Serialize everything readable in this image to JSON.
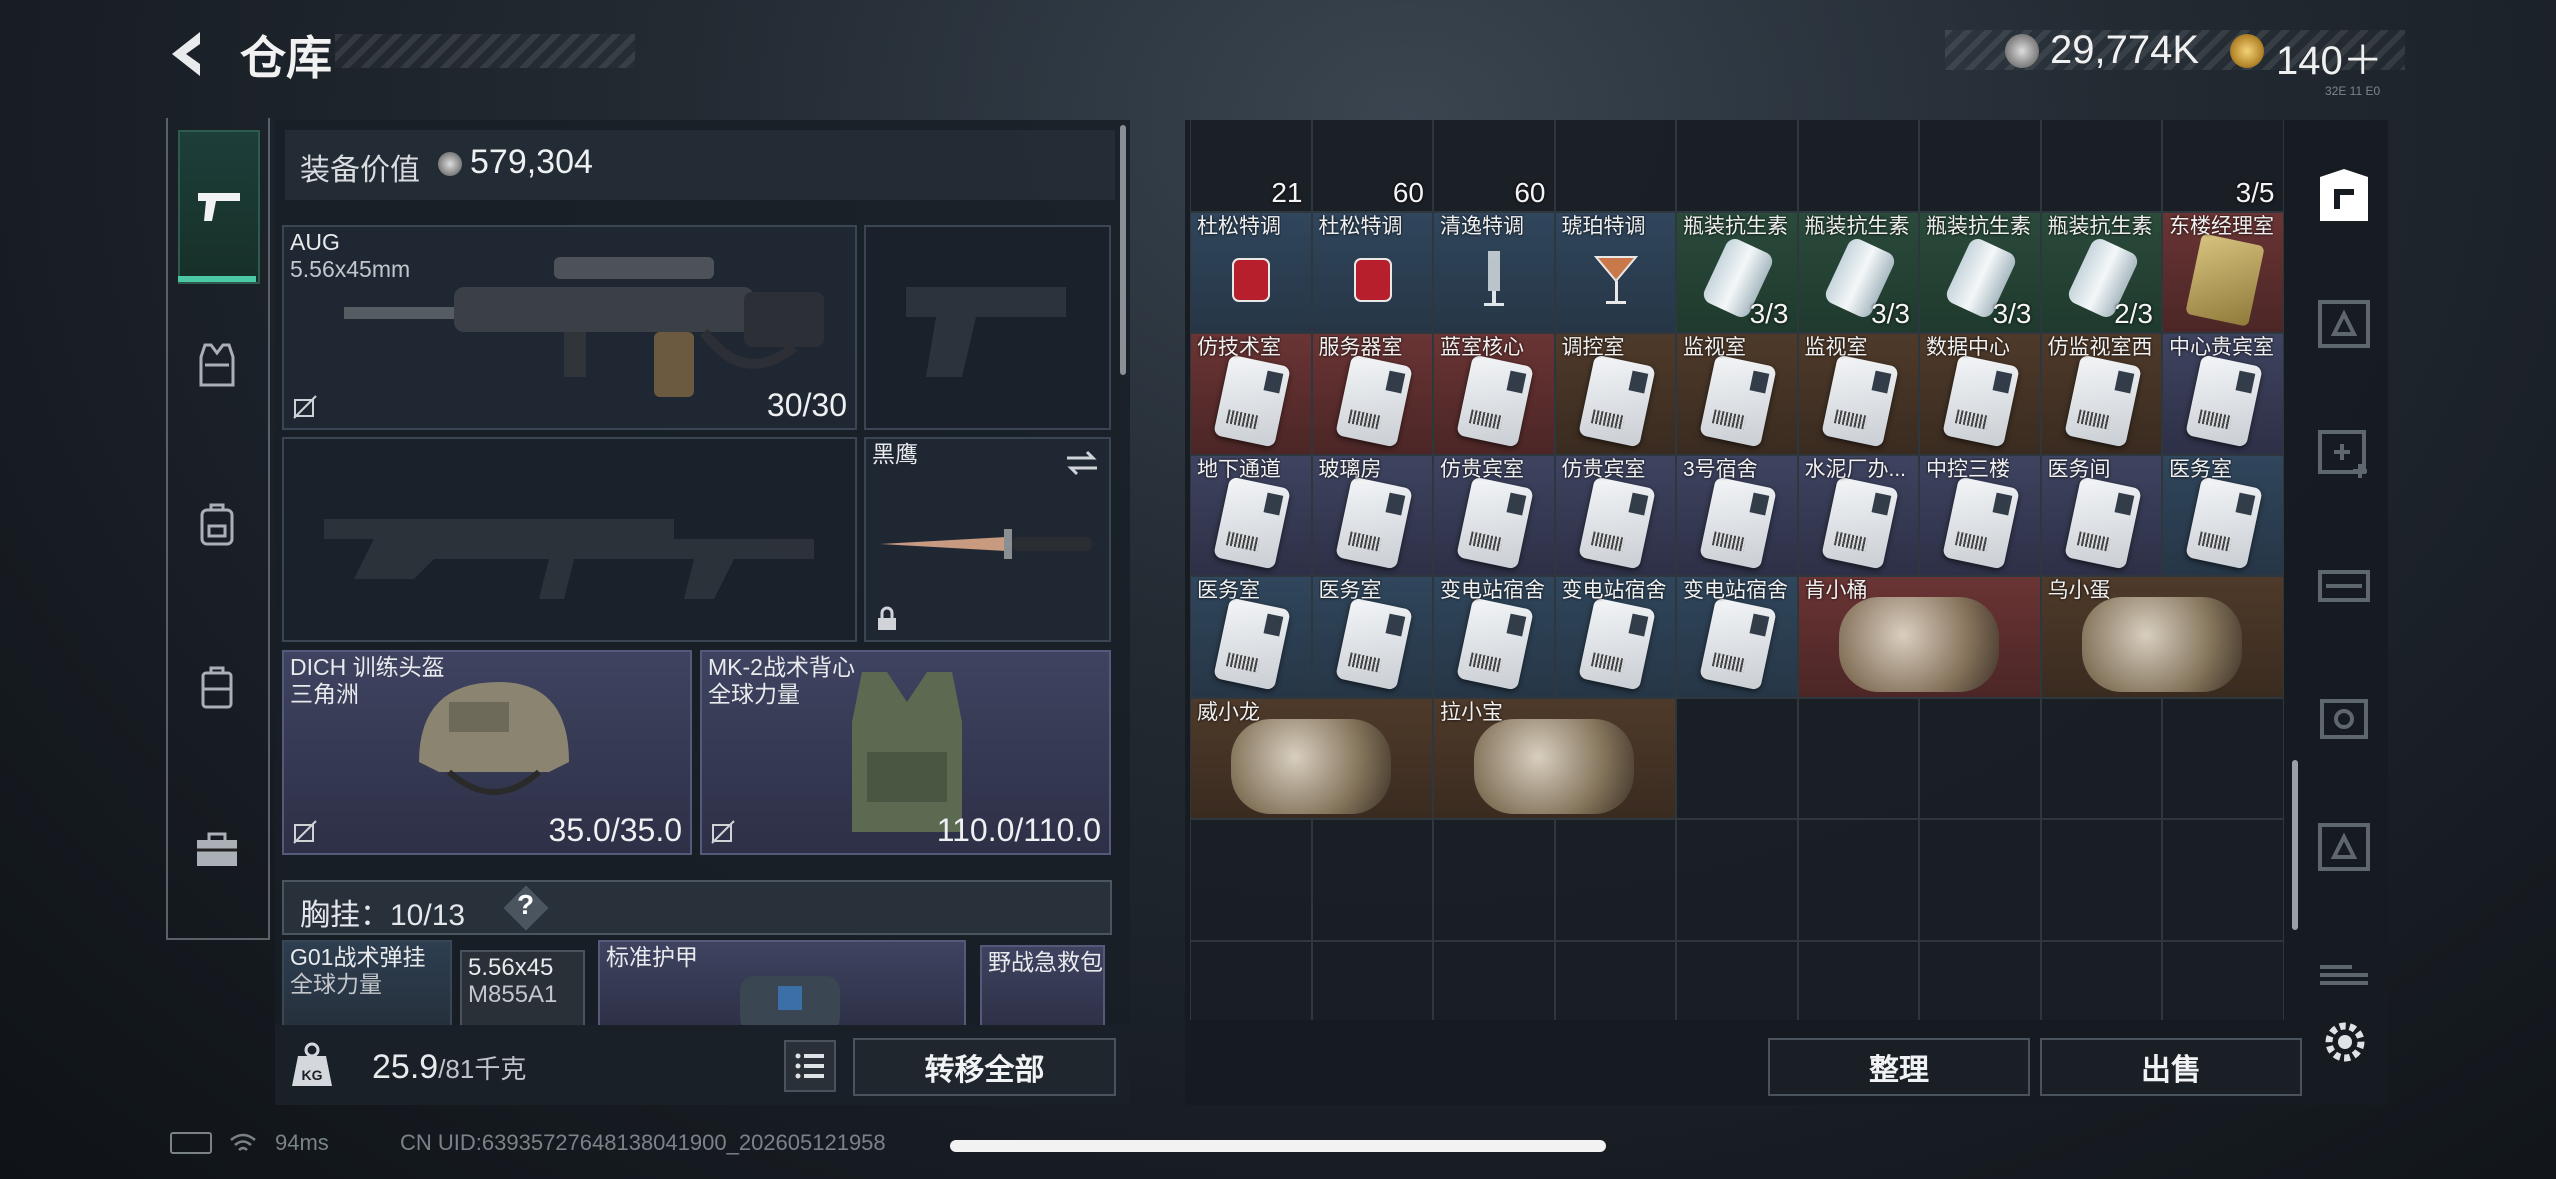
{
  "header": {
    "title": "仓库",
    "currency1": "29,774K",
    "currency2": "140＋",
    "version_text": "32E 11 E0"
  },
  "left_panel": {
    "value_label": "装备价值",
    "value": "579,304",
    "slots": {
      "primary": {
        "name": "AUG",
        "ammo_type": "5.56x45mm",
        "count": "30/30"
      },
      "melee": {
        "name": "黑鹰"
      },
      "helmet": {
        "name": "DICH 训练头盔",
        "brand": "三角洲",
        "durability": "35.0/35.0"
      },
      "armor": {
        "name": "MK-2战术背心",
        "brand": "全球力量",
        "durability": "110.0/110.0"
      }
    },
    "chest_label": "胸挂：",
    "chest_count": "10/13",
    "chest_help": "?",
    "chest_items": {
      "rig_name": "G01战术弹挂",
      "rig_brand": "全球力量",
      "ammo_line1": "5.56x45",
      "ammo_line2": "M855A1",
      "armor_plate": "标准护甲",
      "medkit": "野战急救包"
    },
    "weight_value": "25.9",
    "weight_max": "/81千克",
    "transfer_all": "转移全部"
  },
  "grid": {
    "row0_counts": [
      "21",
      "60",
      "60",
      "",
      "",
      "",
      "",
      "",
      "3/5"
    ],
    "rows": [
      [
        {
          "label": "杜松特调",
          "color": "c-blue",
          "kind": "glass-red"
        },
        {
          "label": "杜松特调",
          "color": "c-blue",
          "kind": "glass-red"
        },
        {
          "label": "清逸特调",
          "color": "c-blue",
          "kind": "glass-clear"
        },
        {
          "label": "琥珀特调",
          "color": "c-blue",
          "kind": "glass-amber"
        },
        {
          "label": "瓶装抗生素",
          "color": "c-green",
          "kind": "vial",
          "count": "3/3"
        },
        {
          "label": "瓶装抗生素",
          "color": "c-green",
          "kind": "vial",
          "count": "3/3"
        },
        {
          "label": "瓶装抗生素",
          "color": "c-green",
          "kind": "vial",
          "count": "3/3"
        },
        {
          "label": "瓶装抗生素",
          "color": "c-green",
          "kind": "vial",
          "count": "2/3"
        },
        {
          "label": "东楼经理室",
          "color": "c-red",
          "kind": "gold"
        }
      ],
      [
        {
          "label": "仿技术室",
          "color": "c-red",
          "kind": "card"
        },
        {
          "label": "服务器室",
          "color": "c-red",
          "kind": "card"
        },
        {
          "label": "蓝室核心",
          "color": "c-red",
          "kind": "card"
        },
        {
          "label": "调控室",
          "color": "c-brown",
          "kind": "card"
        },
        {
          "label": "监视室",
          "color": "c-brown",
          "kind": "card"
        },
        {
          "label": "监视室",
          "color": "c-brown",
          "kind": "card"
        },
        {
          "label": "数据中心",
          "color": "c-brown",
          "kind": "card"
        },
        {
          "label": "仿监视室西",
          "color": "c-brown",
          "kind": "card"
        },
        {
          "label": "中心贵宾室",
          "color": "c-purple",
          "kind": "card"
        }
      ],
      [
        {
          "label": "地下通道",
          "color": "c-purple",
          "kind": "card"
        },
        {
          "label": "玻璃房",
          "color": "c-purple",
          "kind": "card"
        },
        {
          "label": "仿贵宾室",
          "color": "c-purple",
          "kind": "card"
        },
        {
          "label": "仿贵宾室",
          "color": "c-purple",
          "kind": "card"
        },
        {
          "label": "3号宿舍",
          "color": "c-purple",
          "kind": "card"
        },
        {
          "label": "水泥厂办...",
          "color": "c-purple",
          "kind": "card"
        },
        {
          "label": "中控三楼",
          "color": "c-purple",
          "kind": "card"
        },
        {
          "label": "医务间",
          "color": "c-purple",
          "kind": "card"
        },
        {
          "label": "医务室",
          "color": "c-blue",
          "kind": "card"
        }
      ],
      [
        {
          "label": "医务室",
          "color": "c-blue",
          "kind": "card"
        },
        {
          "label": "医务室",
          "color": "c-blue",
          "kind": "card"
        },
        {
          "label": "变电站宿舍",
          "color": "c-blue",
          "kind": "card"
        },
        {
          "label": "变电站宿舍",
          "color": "c-blue",
          "kind": "card"
        },
        {
          "label": "变电站宿舍",
          "color": "c-blue",
          "kind": "card"
        }
      ]
    ],
    "wide_items": [
      {
        "label": "肯小桶",
        "color": "c-red"
      },
      {
        "label": "乌小蛋",
        "color": "c-brown"
      },
      {
        "label": "威小龙",
        "color": "c-brown"
      },
      {
        "label": "拉小宝",
        "color": "c-brown"
      }
    ],
    "sort": "整理",
    "sell": "出售"
  },
  "status": {
    "ping": "94ms",
    "uid": "CN UID:6393572764813804190​0_202605121958"
  },
  "icons": [
    "back-icon",
    "pistol-icon",
    "vest-icon",
    "backpack-icon",
    "case-icon",
    "toolbox-icon",
    "safe-icon",
    "settings-icon",
    "kg-icon",
    "list-icon",
    "swap-icon",
    "lock-icon"
  ]
}
